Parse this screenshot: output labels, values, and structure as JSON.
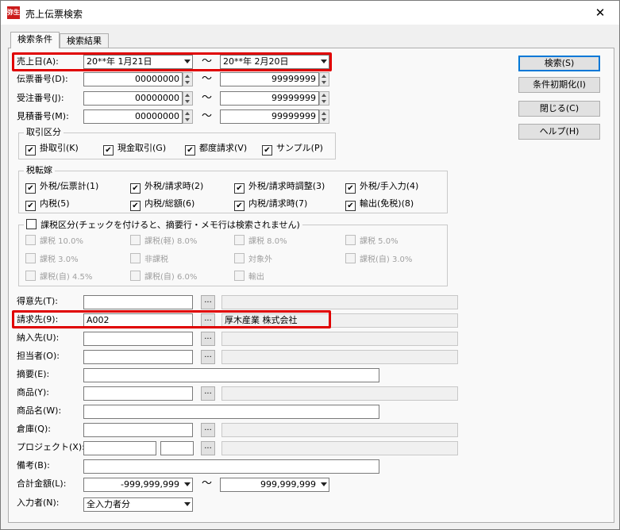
{
  "window": {
    "title": "売上伝票検索",
    "app_icon_text": "弥生",
    "close_glyph": "✕"
  },
  "tabs": [
    {
      "label": "検索条件"
    },
    {
      "label": "検索結果"
    }
  ],
  "buttons": {
    "search": "検索(S)",
    "reset": "条件初期化(I)",
    "close": "閉じる(C)",
    "help": "ヘルプ(H)"
  },
  "tilde": "〜",
  "sales_date": {
    "label": "売上日(A):",
    "from": "20**年 1月21日",
    "to": "20**年 2月20日"
  },
  "slip_no": {
    "label": "伝票番号(D):",
    "from": "00000000",
    "to": "99999999"
  },
  "order_no": {
    "label": "受注番号(J):",
    "from": "00000000",
    "to": "99999999"
  },
  "estimate_no": {
    "label": "見積番号(M):",
    "from": "00000000",
    "to": "99999999"
  },
  "transaction_type": {
    "title": "取引区分",
    "items": [
      "掛取引(K)",
      "現金取引(G)",
      "都度請求(V)",
      "サンプル(P)"
    ]
  },
  "tax_method": {
    "title": "税転嫁",
    "row1": [
      "外税/伝票計(1)",
      "外税/請求時(2)",
      "外税/請求時調整(3)",
      "外税/手入力(4)"
    ],
    "row2": [
      "内税(5)",
      "内税/総額(6)",
      "内税/請求時(7)",
      "輸出(免税)(8)"
    ]
  },
  "tax_category": {
    "title": "課税区分(チェックを付けると、摘要行・メモ行は検索されません)",
    "row1": [
      "課税 10.0%",
      "課税(軽) 8.0%",
      "課税 8.0%",
      "課税 5.0%"
    ],
    "row2": [
      "課税 3.0%",
      "非課税",
      "対象外",
      "課税(自) 3.0%"
    ],
    "row3": [
      "課税(自) 4.5%",
      "課税(自) 6.0%",
      "輸出"
    ]
  },
  "customer": {
    "label": "得意先(T):",
    "value": "",
    "name": ""
  },
  "billing": {
    "label": "請求先(9):",
    "value": "A002",
    "name": "厚木産業 株式会社"
  },
  "delivery": {
    "label": "納入先(U):",
    "value": "",
    "name": ""
  },
  "staff": {
    "label": "担当者(O):",
    "value": "",
    "name": ""
  },
  "summary": {
    "label": "摘要(E):",
    "value": ""
  },
  "product": {
    "label": "商品(Y):",
    "value": "",
    "name": ""
  },
  "product_name": {
    "label": "商品名(W):",
    "value": ""
  },
  "warehouse": {
    "label": "倉庫(Q):",
    "value": "",
    "name": ""
  },
  "project": {
    "label": "プロジェクト(X):",
    "value1": "",
    "value2": "",
    "name": ""
  },
  "remarks": {
    "label": "備考(B):",
    "value": ""
  },
  "total_amount": {
    "label": "合計金額(L):",
    "from": "-999,999,999",
    "to": "999,999,999"
  },
  "entered_by": {
    "label": "入力者(N):",
    "value": "全入力者分"
  },
  "dots_glyph": "...",
  "check_glyph": "✔"
}
